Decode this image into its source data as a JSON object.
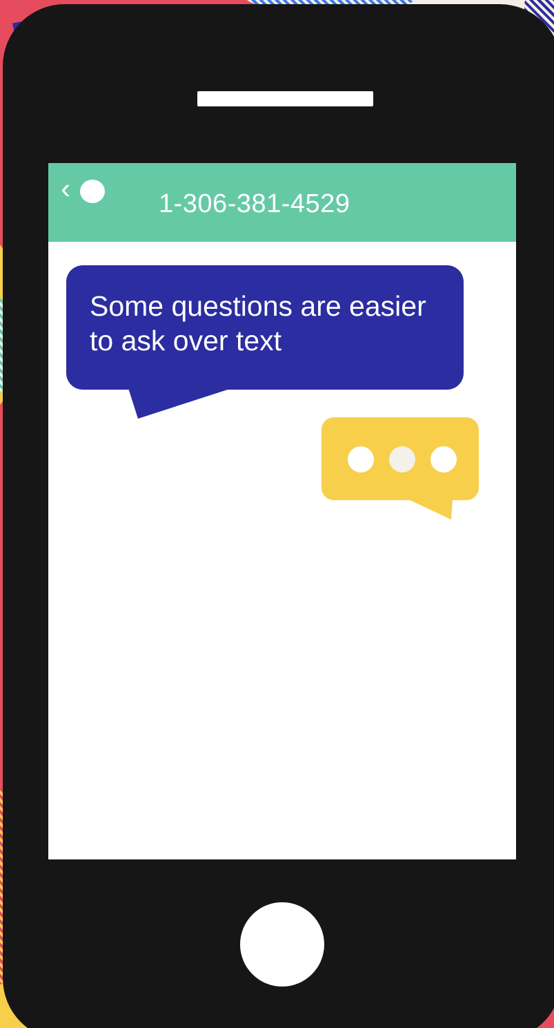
{
  "header": {
    "back_icon": "chevron-left-icon",
    "contact_icon": "avatar-dot",
    "phone_number": "1-306-381-4529"
  },
  "conversation": {
    "incoming_message": "Some questions are easier to ask over text",
    "typing_indicator": "typing-dots-icon"
  },
  "colors": {
    "header": "#66c9a6",
    "incoming_bubble": "#2b2da0",
    "typing_bubble": "#f8cf4a",
    "phone_body": "#161616"
  }
}
